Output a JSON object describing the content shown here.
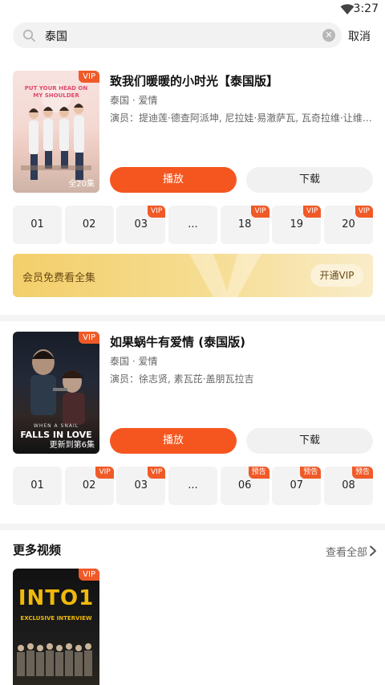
{
  "status_bar": {
    "time": "3:27"
  },
  "search": {
    "query": "泰国",
    "cancel_label": "取消"
  },
  "results": [
    {
      "title": "致我们暖暖的小时光【泰国版】",
      "meta": "泰国 · 爱情",
      "cast": "演员：提迪莲·德查阿派坤, 尼拉娃·易澈萨瓦, 瓦奇拉维·让维…",
      "poster_badge": "VIP",
      "poster_text": "PUT YOUR HEAD ON MY SHOULDER",
      "poster_foot": "全20集",
      "play_label": "播放",
      "download_label": "下载",
      "episodes": [
        {
          "label": "01",
          "tag": ""
        },
        {
          "label": "02",
          "tag": ""
        },
        {
          "label": "03",
          "tag": "VIP"
        },
        {
          "label": "...",
          "tag": ""
        },
        {
          "label": "18",
          "tag": "VIP"
        },
        {
          "label": "19",
          "tag": "VIP"
        },
        {
          "label": "20",
          "tag": "VIP"
        }
      ],
      "vip_banner": {
        "text": "会员免费看全集",
        "button": "开通VIP"
      }
    },
    {
      "title": "如果蜗牛有爱情 (泰国版)",
      "meta": "泰国 · 爱情",
      "cast": "演员：徐志贤, 素瓦芘·盖朋瓦拉吉",
      "poster_badge": "VIP",
      "poster_text_small": "WHEN A SNAIL",
      "poster_text": "FALLS IN LOVE",
      "poster_foot": "更新到第6集",
      "play_label": "播放",
      "download_label": "下载",
      "episodes": [
        {
          "label": "01",
          "tag": ""
        },
        {
          "label": "02",
          "tag": "VIP"
        },
        {
          "label": "03",
          "tag": "VIP"
        },
        {
          "label": "...",
          "tag": ""
        },
        {
          "label": "06",
          "tag": "预告"
        },
        {
          "label": "07",
          "tag": "预告"
        },
        {
          "label": "08",
          "tag": "预告"
        }
      ]
    }
  ],
  "more_videos": {
    "heading": "更多视频",
    "view_all": "查看全部",
    "items": [
      {
        "poster_badge": "VIP",
        "poster_title": "INTO1",
        "poster_subtitle": "EXCLUSIVE INTERVIEW"
      }
    ]
  },
  "colors": {
    "accent": "#f5561f",
    "vip_tag": "#f05a28",
    "vip_banner": "#f3cf6a"
  }
}
